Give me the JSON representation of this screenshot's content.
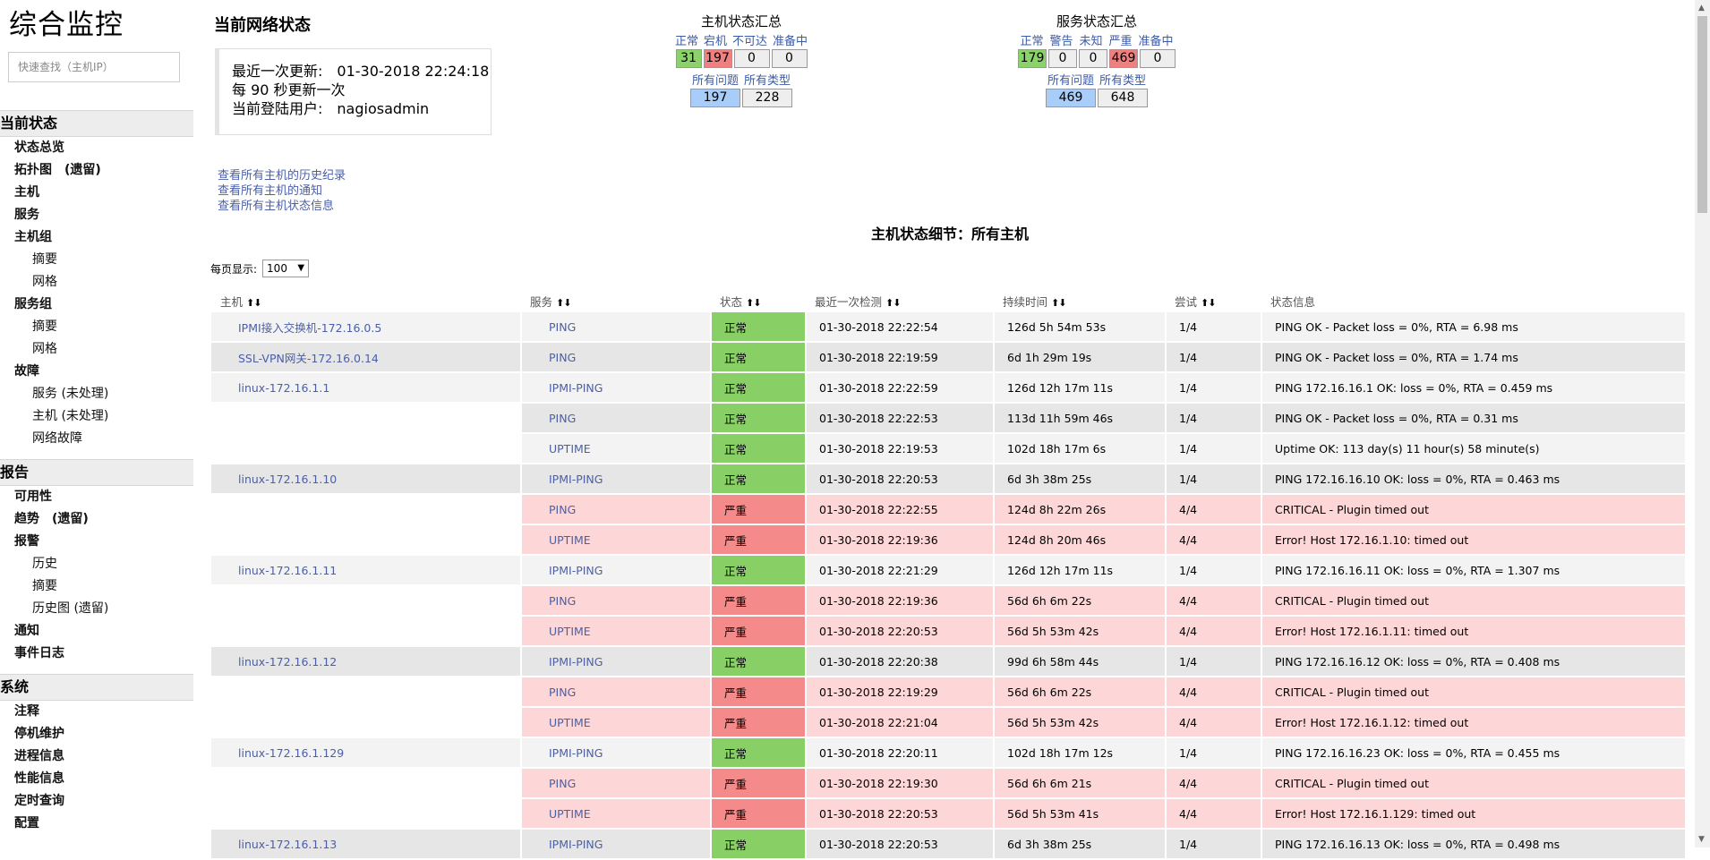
{
  "app_title": "综合监控",
  "search": {
    "placeholder": "快速查找（主机IP）"
  },
  "sidebar": [
    {
      "header": "当前状态",
      "items": [
        {
          "label": "状态总览",
          "level": 0
        },
        {
          "label": "拓扑图　(遗留)",
          "level": 0
        },
        {
          "label": "主机",
          "level": 0
        },
        {
          "label": "服务",
          "level": 0
        },
        {
          "label": "主机组",
          "level": 0
        },
        {
          "label": "摘要",
          "level": 1
        },
        {
          "label": "网格",
          "level": 1
        },
        {
          "label": "服务组",
          "level": 0
        },
        {
          "label": "摘要",
          "level": 1
        },
        {
          "label": "网格",
          "level": 1
        },
        {
          "label": "故障",
          "level": 0
        },
        {
          "label": "服务 (未处理)",
          "level": 1
        },
        {
          "label": "主机 (未处理)",
          "level": 1
        },
        {
          "label": "网络故障",
          "level": 1
        }
      ]
    },
    {
      "header": "报告",
      "items": [
        {
          "label": "可用性",
          "level": 0
        },
        {
          "label": "趋势　(遗留)",
          "level": 0
        },
        {
          "label": "报警",
          "level": 0
        },
        {
          "label": "历史",
          "level": 1
        },
        {
          "label": "摘要",
          "level": 1
        },
        {
          "label": "历史图 (遗留)",
          "level": 1
        },
        {
          "label": "通知",
          "level": 0
        },
        {
          "label": "事件日志",
          "level": 0
        }
      ]
    },
    {
      "header": "系统",
      "items": [
        {
          "label": "注释",
          "level": 0
        },
        {
          "label": "停机维护",
          "level": 0
        },
        {
          "label": "进程信息",
          "level": 0
        },
        {
          "label": "性能信息",
          "level": 0
        },
        {
          "label": "定时查询",
          "level": 0
        },
        {
          "label": "配置",
          "level": 0
        }
      ]
    }
  ],
  "network_status": {
    "title": "当前网络状态",
    "last_update": "最近一次更新:　01-30-2018 22:24:18",
    "refresh": "每 90 秒更新一次",
    "user": "当前登陆用户:　nagiosadmin"
  },
  "links": [
    "查看所有主机的历史纪录",
    "查看所有主机的通知",
    "查看所有主机状态信息"
  ],
  "host_summary": {
    "title": "主机状态汇总",
    "headers": [
      "正常",
      "宕机",
      "不可达",
      "准备中"
    ],
    "values": [
      "31",
      "197",
      "0",
      "0"
    ],
    "headers2": [
      "所有问题",
      "所有类型"
    ],
    "values2": [
      "197",
      "228"
    ]
  },
  "service_summary": {
    "title": "服务状态汇总",
    "headers": [
      "正常",
      "警告",
      "未知",
      "严重",
      "准备中"
    ],
    "values": [
      "179",
      "0",
      "0",
      "469",
      "0"
    ],
    "headers2": [
      "所有问题",
      "所有类型"
    ],
    "values2": [
      "469",
      "648"
    ]
  },
  "detail_title": "主机状态细节：所有主机",
  "pager": {
    "label": "每页显示:",
    "value": "100"
  },
  "columns": [
    "主机",
    "服务",
    "状态",
    "最近一次检测",
    "持续时间",
    "尝试",
    "状态信息"
  ],
  "rows": [
    {
      "host": "IPMI接入交换机-172.16.0.5",
      "service": "PING",
      "status": "正常",
      "checked": "01-30-2018 22:22:54",
      "duration": "126d 5h 54m 53s",
      "attempt": "1/4",
      "info": "PING OK - Packet loss = 0%, RTA = 6.98 ms"
    },
    {
      "host": "SSL-VPN网关-172.16.0.14",
      "service": "PING",
      "status": "正常",
      "checked": "01-30-2018 22:19:59",
      "duration": "6d 1h 29m 19s",
      "attempt": "1/4",
      "info": "PING OK - Packet loss = 0%, RTA = 1.74 ms"
    },
    {
      "host": "linux-172.16.1.1",
      "service": "IPMI-PING",
      "status": "正常",
      "checked": "01-30-2018 22:22:59",
      "duration": "126d 12h 17m 11s",
      "attempt": "1/4",
      "info": "PING 172.16.16.1 OK: loss = 0%, RTA = 0.459 ms"
    },
    {
      "host": "",
      "service": "PING",
      "status": "正常",
      "checked": "01-30-2018 22:22:53",
      "duration": "113d 11h 59m 46s",
      "attempt": "1/4",
      "info": "PING OK - Packet loss = 0%, RTA = 0.31 ms"
    },
    {
      "host": "",
      "service": "UPTIME",
      "status": "正常",
      "checked": "01-30-2018 22:19:53",
      "duration": "102d 18h 17m 6s",
      "attempt": "1/4",
      "info": "Uptime OK: 113 day(s) 11 hour(s) 58 minute(s)"
    },
    {
      "host": "linux-172.16.1.10",
      "service": "IPMI-PING",
      "status": "正常",
      "checked": "01-30-2018 22:20:53",
      "duration": "6d 3h 38m 25s",
      "attempt": "1/4",
      "info": "PING 172.16.16.10 OK: loss = 0%, RTA = 0.463 ms"
    },
    {
      "host": "",
      "service": "PING",
      "status": "严重",
      "checked": "01-30-2018 22:22:55",
      "duration": "124d 8h 22m 26s",
      "attempt": "4/4",
      "info": "CRITICAL - Plugin timed out"
    },
    {
      "host": "",
      "service": "UPTIME",
      "status": "严重",
      "checked": "01-30-2018 22:19:36",
      "duration": "124d 8h 20m 46s",
      "attempt": "4/4",
      "info": "Error! Host 172.16.1.10: timed out"
    },
    {
      "host": "linux-172.16.1.11",
      "service": "IPMI-PING",
      "status": "正常",
      "checked": "01-30-2018 22:21:29",
      "duration": "126d 12h 17m 11s",
      "attempt": "1/4",
      "info": "PING 172.16.16.11 OK: loss = 0%, RTA = 1.307 ms"
    },
    {
      "host": "",
      "service": "PING",
      "status": "严重",
      "checked": "01-30-2018 22:19:36",
      "duration": "56d 6h 6m 22s",
      "attempt": "4/4",
      "info": "CRITICAL - Plugin timed out"
    },
    {
      "host": "",
      "service": "UPTIME",
      "status": "严重",
      "checked": "01-30-2018 22:20:53",
      "duration": "56d 5h 53m 42s",
      "attempt": "4/4",
      "info": "Error! Host 172.16.1.11: timed out"
    },
    {
      "host": "linux-172.16.1.12",
      "service": "IPMI-PING",
      "status": "正常",
      "checked": "01-30-2018 22:20:38",
      "duration": "99d 6h 58m 44s",
      "attempt": "1/4",
      "info": "PING 172.16.16.12 OK: loss = 0%, RTA = 0.408 ms"
    },
    {
      "host": "",
      "service": "PING",
      "status": "严重",
      "checked": "01-30-2018 22:19:29",
      "duration": "56d 6h 6m 22s",
      "attempt": "4/4",
      "info": "CRITICAL - Plugin timed out"
    },
    {
      "host": "",
      "service": "UPTIME",
      "status": "严重",
      "checked": "01-30-2018 22:21:04",
      "duration": "56d 5h 53m 42s",
      "attempt": "4/4",
      "info": "Error! Host 172.16.1.12: timed out"
    },
    {
      "host": "linux-172.16.1.129",
      "service": "IPMI-PING",
      "status": "正常",
      "checked": "01-30-2018 22:20:11",
      "duration": "102d 18h 17m 12s",
      "attempt": "1/4",
      "info": "PING 172.16.16.23 OK: loss = 0%, RTA = 0.455 ms"
    },
    {
      "host": "",
      "service": "PING",
      "status": "严重",
      "checked": "01-30-2018 22:19:30",
      "duration": "56d 6h 6m 21s",
      "attempt": "4/4",
      "info": "CRITICAL - Plugin timed out"
    },
    {
      "host": "",
      "service": "UPTIME",
      "status": "严重",
      "checked": "01-30-2018 22:20:53",
      "duration": "56d 5h 53m 41s",
      "attempt": "4/4",
      "info": "Error! Host 172.16.1.129: timed out"
    },
    {
      "host": "linux-172.16.1.13",
      "service": "IPMI-PING",
      "status": "正常",
      "checked": "01-30-2018 22:20:53",
      "duration": "6d 3h 38m 25s",
      "attempt": "1/4",
      "info": "PING 172.16.16.13 OK: loss = 0%, RTA = 0.498 ms"
    }
  ],
  "colors": {
    "ok": "#88d066",
    "critical": "#f48a8a",
    "link": "#4a5fa8",
    "row_critical": "#fdd7d7"
  }
}
